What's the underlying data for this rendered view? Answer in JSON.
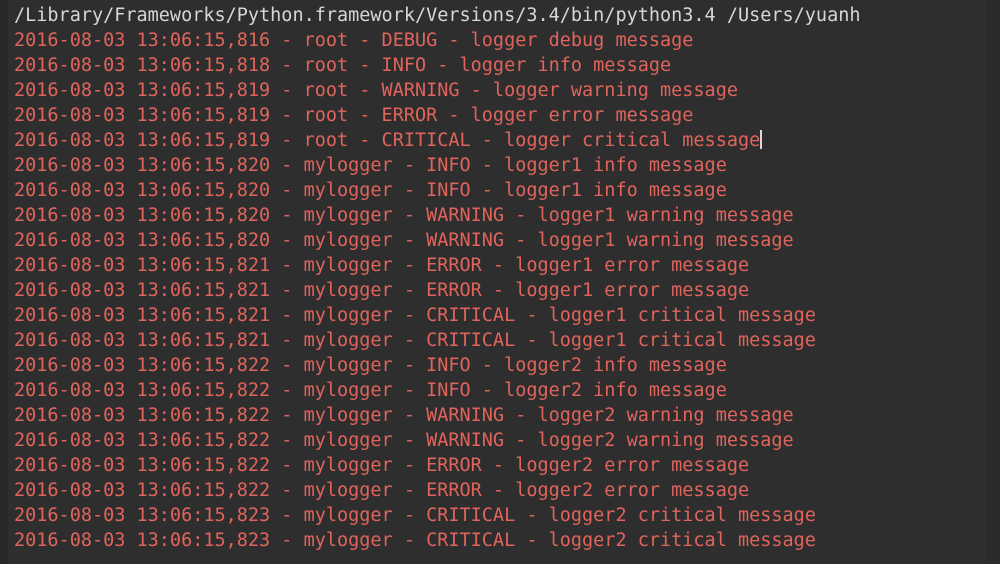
{
  "console": {
    "app_context": "python-console-output",
    "background_color": "#2e2e2e",
    "gutter_color": "#272727",
    "interpreter_text_color": "#d6d6d6",
    "log_text_color": "#e0645c",
    "caret_color": "#d8d8d8",
    "interpreter_line": "/Library/Frameworks/Python.framework/Versions/3.4/bin/python3.4 /Users/yuanh",
    "caret_on_line_index": 4,
    "lines": [
      "2016-08-03 13:06:15,816 - root - DEBUG - logger debug message",
      "2016-08-03 13:06:15,818 - root - INFO - logger info message",
      "2016-08-03 13:06:15,819 - root - WARNING - logger warning message",
      "2016-08-03 13:06:15,819 - root - ERROR - logger error message",
      "2016-08-03 13:06:15,819 - root - CRITICAL - logger critical message",
      "2016-08-03 13:06:15,820 - mylogger - INFO - logger1 info message",
      "2016-08-03 13:06:15,820 - mylogger - INFO - logger1 info message",
      "2016-08-03 13:06:15,820 - mylogger - WARNING - logger1 warning message",
      "2016-08-03 13:06:15,820 - mylogger - WARNING - logger1 warning message",
      "2016-08-03 13:06:15,821 - mylogger - ERROR - logger1 error message",
      "2016-08-03 13:06:15,821 - mylogger - ERROR - logger1 error message",
      "2016-08-03 13:06:15,821 - mylogger - CRITICAL - logger1 critical message",
      "2016-08-03 13:06:15,821 - mylogger - CRITICAL - logger1 critical message",
      "2016-08-03 13:06:15,822 - mylogger - INFO - logger2 info message",
      "2016-08-03 13:06:15,822 - mylogger - INFO - logger2 info message",
      "2016-08-03 13:06:15,822 - mylogger - WARNING - logger2 warning message",
      "2016-08-03 13:06:15,822 - mylogger - WARNING - logger2 warning message",
      "2016-08-03 13:06:15,822 - mylogger - ERROR - logger2 error message",
      "2016-08-03 13:06:15,822 - mylogger - ERROR - logger2 error message",
      "2016-08-03 13:06:15,823 - mylogger - CRITICAL - logger2 critical message",
      "2016-08-03 13:06:15,823 - mylogger - CRITICAL - logger2 critical message"
    ]
  }
}
